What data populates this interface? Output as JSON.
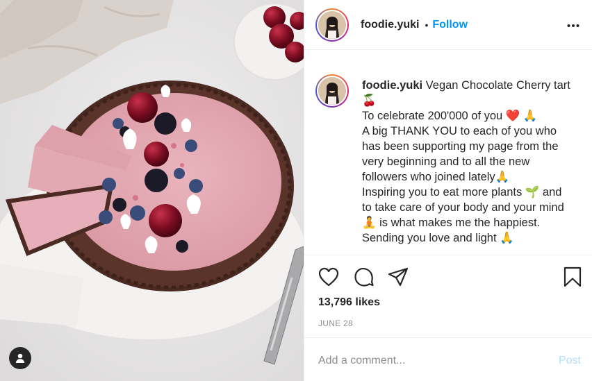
{
  "post": {
    "image_alt": "Vegan chocolate cherry tart"
  },
  "header": {
    "username": "foodie.yuki",
    "separator": "•",
    "follow_label": "Follow",
    "more_icon": "more-options-icon"
  },
  "caption": {
    "username": "foodie.yuki",
    "text": " Vegan Chocolate Cherry tart 🍒\nTo celebrate 200'000 of you ❤️ 🙏\nA big THANK YOU to each of you who has been supporting my page from the very beginning and to all the new followers who joined lately🙏\nInspiring you to eat more plants 🌱 and to take care of your body and your mind 🧘 is what makes me the happiest.\nSending you love and light 🙏"
  },
  "actions": {
    "like_icon": "heart-icon",
    "comment_icon": "comment-icon",
    "share_icon": "share-icon",
    "save_icon": "bookmark-icon"
  },
  "stats": {
    "likes": "13,796 likes",
    "date": "JUNE 28"
  },
  "comment": {
    "placeholder": "Add a comment...",
    "post_label": "Post"
  },
  "colors": {
    "accent": "#0095f6",
    "post_disabled": "#b2dffc",
    "muted": "#8e8e8e",
    "text": "#262626",
    "divider": "#efefef"
  }
}
